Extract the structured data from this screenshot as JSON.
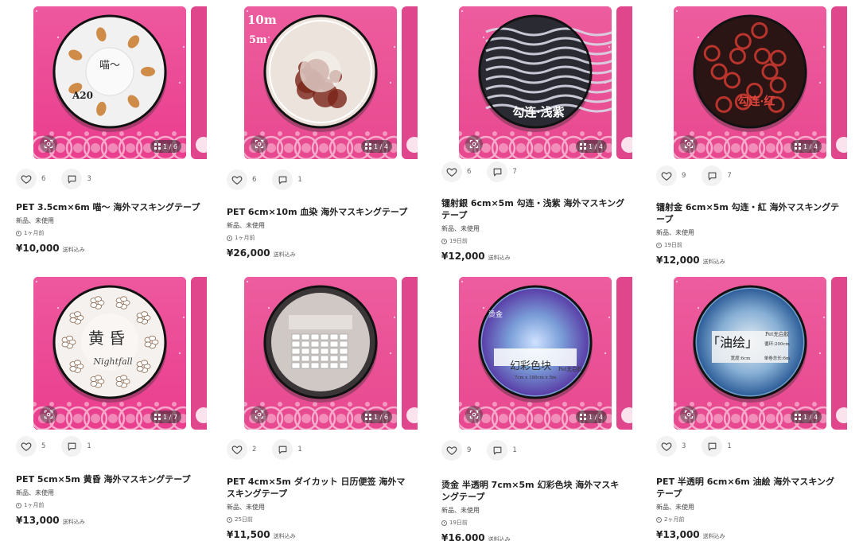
{
  "products": [
    {
      "title": "PET 3.5cm×6m 喵～ 海外マスキングテープ",
      "condition": "新品、未使用",
      "time_ago": "1ヶ月前",
      "price": "¥10,000",
      "shipping": "送料込み",
      "likes": "6",
      "comments": "3",
      "page_counter": "1 / 6",
      "theme": "cat",
      "tape_texts": [
        "喵～",
        "A20"
      ],
      "colors": {
        "bg": "#ea3d8e",
        "tape": "#f1f1f1",
        "accent": "#c97a2a"
      }
    },
    {
      "title": "PET 6cm×10m 血染 海外マスキングテープ",
      "condition": "新品、未使用",
      "time_ago": "1ヶ月前",
      "price": "¥26,000",
      "shipping": "送料込み",
      "likes": "6",
      "comments": "1",
      "page_counter": "1 / 4",
      "theme": "blood",
      "tape_texts": [
        "10m",
        "5m"
      ],
      "colors": {
        "bg": "#e8488f",
        "tape": "#ece3dc",
        "accent": "#7a2318"
      }
    },
    {
      "title": "镭射銀 6cm×5m 勾连・浅紫 海外マスキングテープ",
      "condition": "新品、未使用",
      "time_ago": "19日前",
      "price": "¥12,000",
      "shipping": "送料込み",
      "likes": "6",
      "comments": "7",
      "page_counter": "1 / 4",
      "theme": "silver",
      "tape_texts": [
        "勾连·浅紫"
      ],
      "colors": {
        "bg": "#e8488f",
        "tape": "#2a2a33",
        "accent": "#d8d8e6"
      }
    },
    {
      "title": "镭射金 6cm×5m 勾连・紅 海外マスキングテープ",
      "condition": "新品、未使用",
      "time_ago": "19日前",
      "price": "¥12,000",
      "shipping": "送料込み",
      "likes": "9",
      "comments": "7",
      "page_counter": "1 / 4",
      "theme": "red",
      "tape_texts": [
        "勾连·红"
      ],
      "colors": {
        "bg": "#e8488f",
        "tape": "#2a1414",
        "accent": "#b8342c"
      }
    },
    {
      "title": "PET 5cm×5m 黄昏 海外マスキングテープ",
      "condition": "新品、未使用",
      "time_ago": "1ヶ月前",
      "price": "¥13,000",
      "shipping": "送料込み",
      "likes": "5",
      "comments": "1",
      "page_counter": "1 / 7",
      "theme": "dusk",
      "tape_texts": [
        "黄 昏",
        "Nightfall"
      ],
      "colors": {
        "bg": "#ea3d8e",
        "tape": "#f4f1ee",
        "accent": "#8a6a52"
      }
    },
    {
      "title": "PET 4cm×5m ダイカット 日历便签 海外マスキングテープ",
      "condition": "新品、未使用",
      "time_ago": "25日前",
      "price": "¥11,500",
      "shipping": "送料込み",
      "likes": "2",
      "comments": "1",
      "page_counter": "1 / 6",
      "theme": "calendar",
      "tape_texts": [],
      "colors": {
        "bg": "#e8488f",
        "tape": "#3a3638",
        "accent": "#e6e1de"
      }
    },
    {
      "title": "烫金 半透明 7cm×5m 幻彩色块 海外マスキングテープ",
      "condition": "新品、未使用",
      "time_ago": "19日前",
      "price": "¥16,000",
      "shipping": "送料込み",
      "likes": "9",
      "comments": "1",
      "page_counter": "1 / 4",
      "theme": "iridescent",
      "tape_texts": [
        "幻彩色块",
        "Pet无白胶",
        "烫金",
        "7cm x 180cm x 5m"
      ],
      "colors": {
        "bg": "#e8488f",
        "tape": "#7a9ed8",
        "accent": "#5b6fc2"
      }
    },
    {
      "title": "PET 半透明 6cm×6m 油絵 海外マスキングテープ",
      "condition": "新品、未使用",
      "time_ago": "2ヶ月前",
      "price": "¥13,000",
      "shipping": "送料込み",
      "likes": "3",
      "comments": "1",
      "page_counter": "1 / 4",
      "theme": "oil",
      "tape_texts": [
        "「油绘」",
        "Pet无白胶",
        "循环:200cm",
        "宽度:6cm",
        "单卷总长:6m"
      ],
      "colors": {
        "bg": "#e8488f",
        "tape": "#6f9ec9",
        "accent": "#2f5f9a"
      }
    }
  ],
  "icons": {
    "like": "heart-icon",
    "comment": "comment-icon",
    "scan": "scan-icon",
    "gallery": "grid-icon",
    "time": "clock-icon"
  }
}
